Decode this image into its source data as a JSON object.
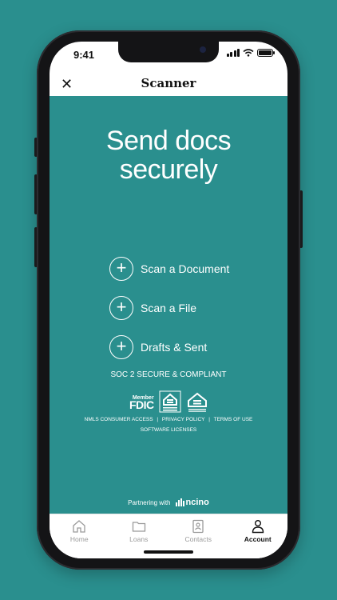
{
  "status": {
    "time": "9:41"
  },
  "header": {
    "title": "Scanner"
  },
  "hero": {
    "line1": "Send docs",
    "line2": "securely"
  },
  "actions": [
    {
      "label": "Scan a Document",
      "icon": "plus-circle-icon"
    },
    {
      "label": "Scan a File",
      "icon": "plus-circle-icon"
    },
    {
      "label": "Drafts & Sent",
      "icon": "plus-circle-icon"
    }
  ],
  "compliance": "SOC 2 SECURE & COMPLIANT",
  "badges": {
    "fdic_member": "Member",
    "fdic": "FDIC"
  },
  "links": {
    "nmls": "NMLS CONSUMER ACCESS",
    "privacy": "PRIVACY POLICY",
    "terms": "TERMS OF USE",
    "licenses": "SOFTWARE LICENSES",
    "separator": "|"
  },
  "partner": {
    "label": "Partnering with",
    "brand": "ncino"
  },
  "tabs": [
    {
      "label": "Home",
      "icon": "home-icon",
      "active": false
    },
    {
      "label": "Loans",
      "icon": "folder-icon",
      "active": false
    },
    {
      "label": "Contacts",
      "icon": "contacts-icon",
      "active": false
    },
    {
      "label": "Account",
      "icon": "person-icon",
      "active": true
    }
  ],
  "colors": {
    "accent": "#2a8f8e",
    "frame": "#141416"
  }
}
